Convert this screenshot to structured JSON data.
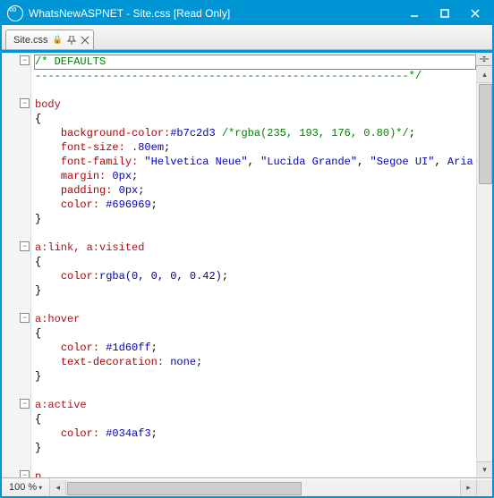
{
  "titlebar": {
    "title": "WhatsNewASPNET - Site.css [Read Only]"
  },
  "tab": {
    "label": "Site.css"
  },
  "zoom": {
    "value": "100 %"
  },
  "code": {
    "l1_a": "/* DEFAULTS",
    "l2_a": "----------------------------------------------------------*/",
    "l4_sel": "body",
    "l5": "{",
    "l6_prop": "background-color:",
    "l6_val": "#b7c2d3",
    "l6_com": " /*rgba(235, 193, 176, 0.80)*/",
    "l6_end": ";",
    "l7_prop": "font-size:",
    "l7_val": " .80em",
    "l7_end": ";",
    "l8_prop": "font-family:",
    "l8_v1": " \"Helvetica Neue\"",
    "l8_c": ", ",
    "l8_v2": "\"Lucida Grande\"",
    "l8_v3": "\"Segoe UI\"",
    "l8_v4": "Aria",
    "l9_prop": "margin:",
    "l9_val": " 0px",
    "l9_end": ";",
    "l10_prop": "padding:",
    "l10_val": " 0px",
    "l10_end": ";",
    "l11_prop": "color:",
    "l11_val": " #696969",
    "l11_end": ";",
    "l12": "}",
    "l14_sel": "a:link, a:visited",
    "l15": "{",
    "l16_prop": "color:",
    "l16_fn": "rgba",
    "l16_args": "(0, 0, 0, 0.42)",
    "l16_end": ";",
    "l17": "}",
    "l19_sel": "a:hover",
    "l20": "{",
    "l21_prop": "color:",
    "l21_val": " #1d60ff",
    "l21_end": ";",
    "l22_prop": "text-decoration:",
    "l22_val": " none",
    "l22_end": ";",
    "l23": "}",
    "l25_sel": "a:active",
    "l26": "{",
    "l27_prop": "color:",
    "l27_val": " #034af3",
    "l27_end": ";",
    "l28": "}",
    "l30_sel": "p"
  }
}
